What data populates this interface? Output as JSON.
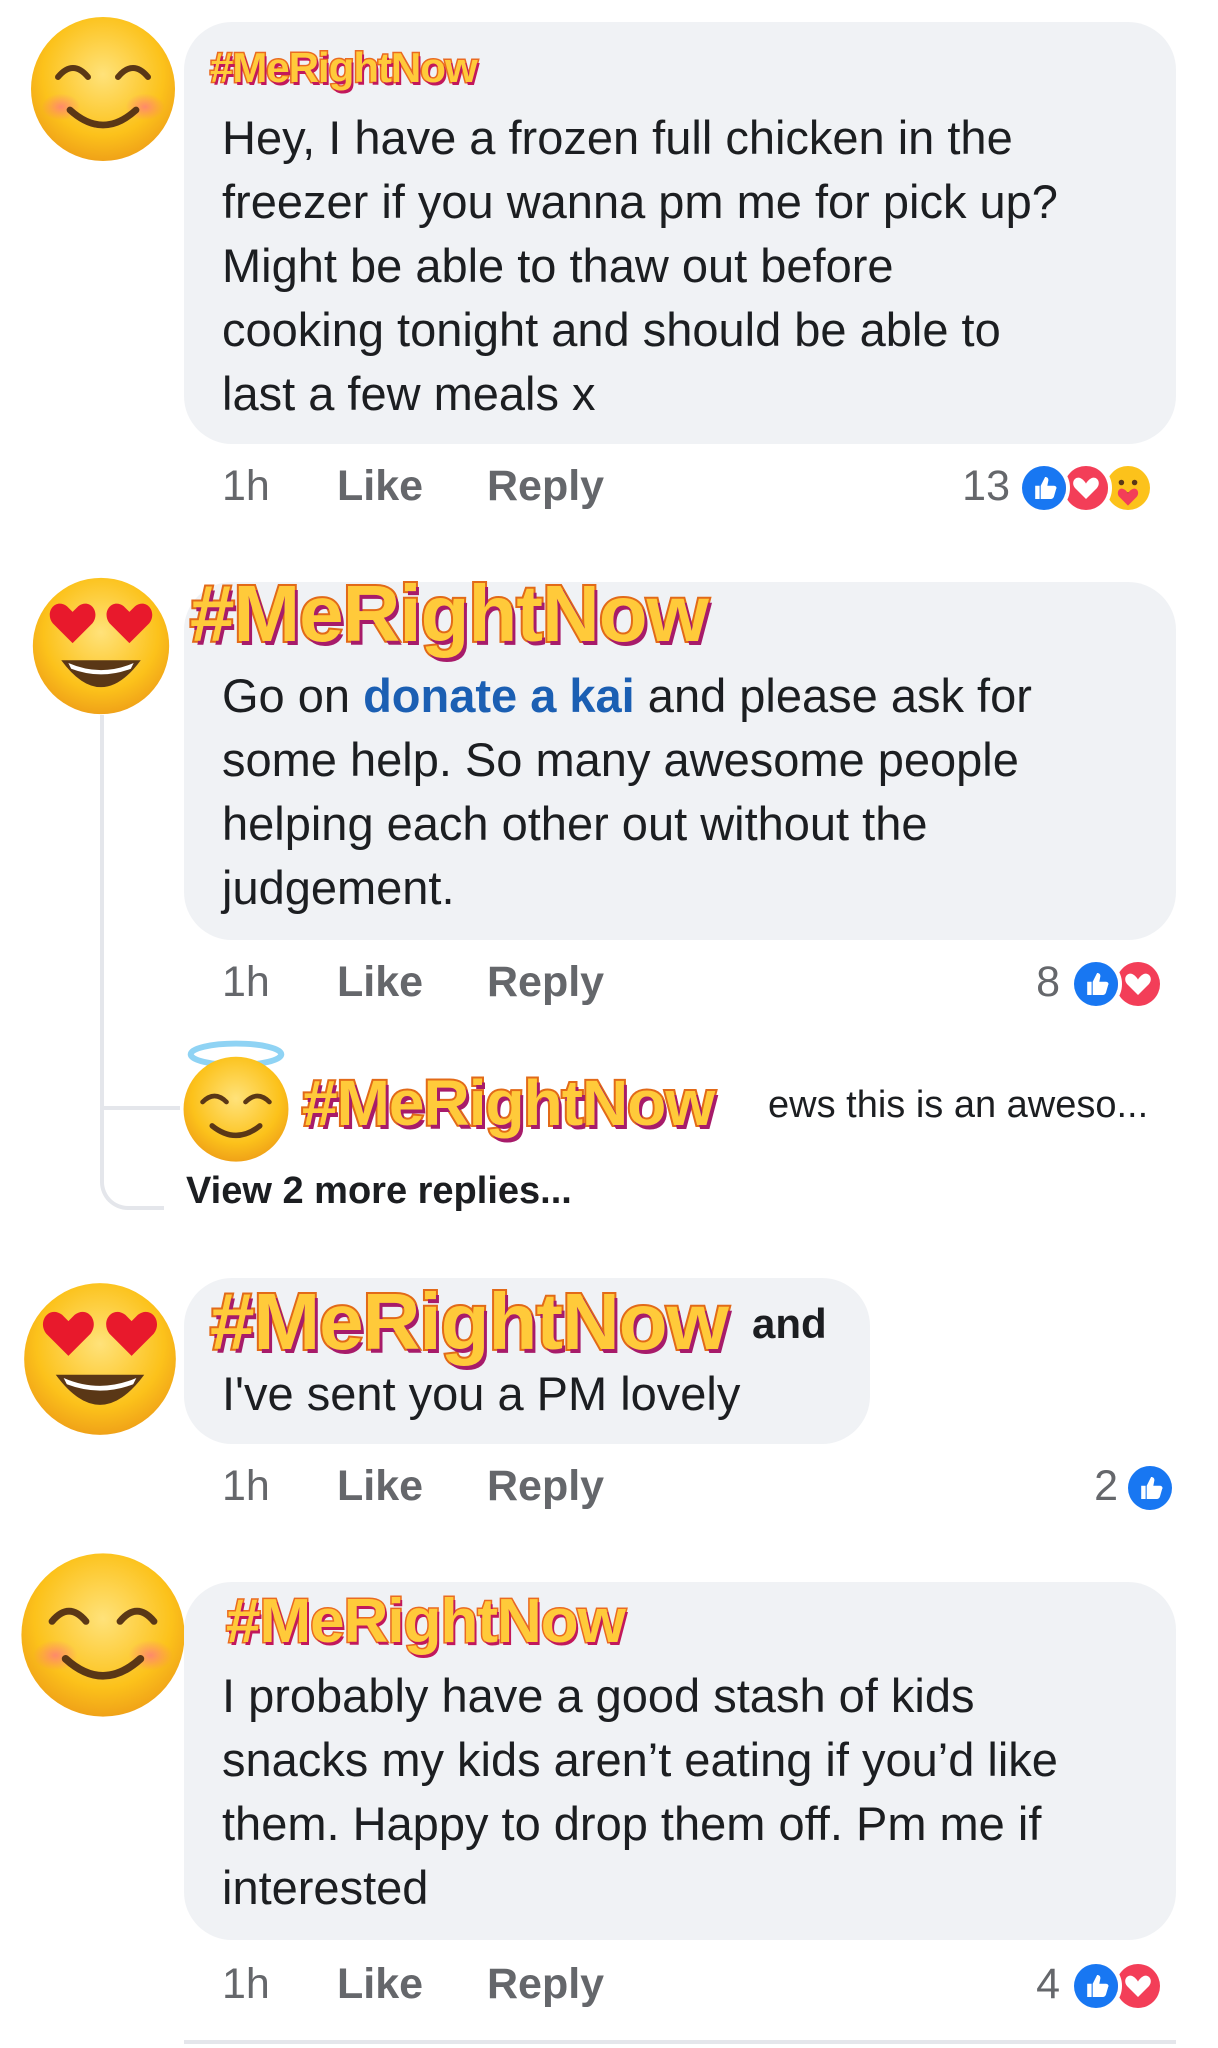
{
  "tag_text": "#MeRightNow",
  "comments": [
    {
      "avatar": "smiling-face-icon",
      "text": "Hey, I have a frozen full chicken in the freezer if you wanna pm me for pick up? Might be able to thaw out before cooking tonight and should be able to last a few meals x",
      "lines": [
        "Hey, I have a frozen full chicken in the",
        "freezer if you wanna pm me for pick up?",
        "Might be able to thaw out before",
        "cooking tonight and should be able to",
        "last a few meals x"
      ],
      "time": "1h",
      "like_label": "Like",
      "reply_label": "Reply",
      "reaction_count": "13",
      "reactions": [
        "like-icon",
        "love-icon",
        "care-icon"
      ]
    },
    {
      "avatar": "heart-eyes-face-icon",
      "text_before": "Go on ",
      "link_text": "donate a kai",
      "text_after_first": " and please ask for",
      "lines_rest": [
        "some help. So many awesome people",
        "helping each other out without the",
        "judgement."
      ],
      "time": "1h",
      "like_label": "Like",
      "reply_label": "Reply",
      "reaction_count": "8",
      "reactions": [
        "like-icon",
        "love-icon"
      ],
      "reply_preview": "ews this is an aweso...",
      "reply_avatar": "halo-face-icon",
      "view_more": "View 2 more replies..."
    },
    {
      "avatar": "heart-eyes-face-icon",
      "name_suffix": "and",
      "lines": [
        "I've sent you a PM lovely"
      ],
      "time": "1h",
      "like_label": "Like",
      "reply_label": "Reply",
      "reaction_count": "2",
      "reactions": [
        "like-icon"
      ]
    },
    {
      "avatar": "smiling-face-icon",
      "lines": [
        "I probably have a good stash of kids",
        "snacks my kids aren’t eating if you’d like",
        "them. Happy to drop them off. Pm me if",
        "interested"
      ],
      "time": "1h",
      "like_label": "Like",
      "reply_label": "Reply",
      "reaction_count": "4",
      "reactions": [
        "like-icon",
        "love-icon"
      ]
    }
  ],
  "colors": {
    "bubble": "#f0f2f5",
    "link": "#1b5fb3",
    "meta": "#65676b",
    "like_blue": "#1877f2",
    "love_red": "#f33e58",
    "tag_fill": "#ffca3a",
    "tag_stroke": "#ea6b21"
  }
}
